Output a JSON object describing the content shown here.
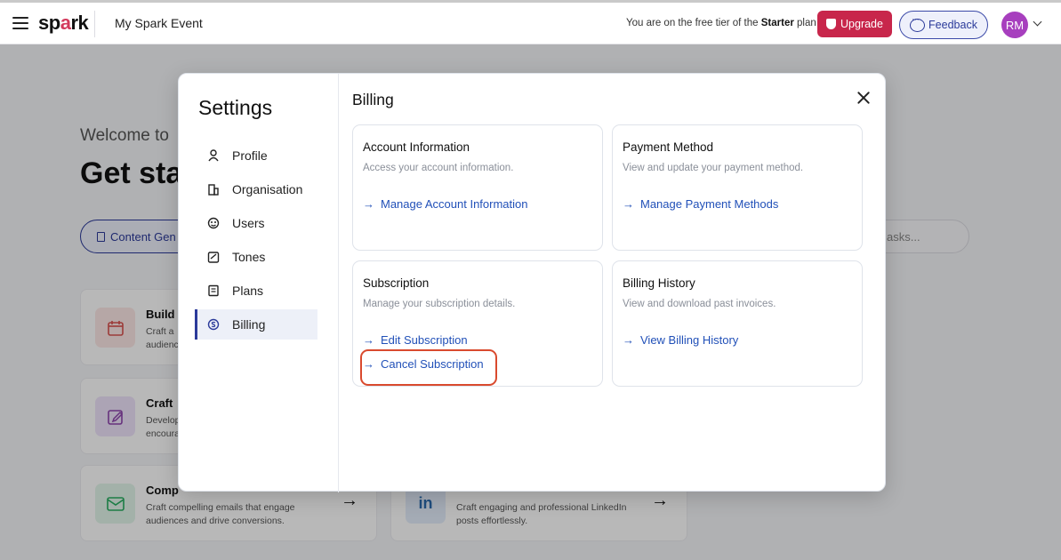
{
  "topbar": {
    "logo_pre": "sp",
    "logo_accent": "a",
    "logo_post": "rk",
    "event_name": "My Spark Event",
    "tier_prefix": "You are on the free tier of the",
    "tier_plan": "Starter",
    "tier_suffix": "plan",
    "upgrade_label": "Upgrade",
    "feedback_label": "Feedback",
    "avatar_initials": "RM"
  },
  "background": {
    "welcome": "Welcome to",
    "heading": "Get sta",
    "content_pill": "Content Gen",
    "search_placeholder": "asks...",
    "cards": [
      {
        "title": "Build",
        "desc": "Craft a\naudienc",
        "icon": "calendar-icon",
        "color": "#fde8e6"
      },
      {
        "title": "Craft",
        "desc": "Develop\nencoura",
        "icon": "edit-icon",
        "color": "#efe4fb"
      },
      {
        "title": "Comp",
        "desc": "Craft compelling emails that engage audiences and drive conversions.",
        "icon": "mail-icon",
        "color": "#e2f5ea"
      },
      {
        "title": "",
        "desc": "Craft engaging and professional LinkedIn posts effortlessly.",
        "icon": "linkedin-icon",
        "color": "#e3edfb"
      }
    ]
  },
  "modal": {
    "settings_title": "Settings",
    "nav": [
      {
        "label": "Profile",
        "icon": "user-icon"
      },
      {
        "label": "Organisation",
        "icon": "building-icon"
      },
      {
        "label": "Users",
        "icon": "users-icon"
      },
      {
        "label": "Tones",
        "icon": "tones-icon"
      },
      {
        "label": "Plans",
        "icon": "plans-icon"
      },
      {
        "label": "Billing",
        "icon": "billing-icon",
        "active": true
      }
    ],
    "billing_title": "Billing",
    "cards": {
      "account": {
        "title": "Account Information",
        "desc": "Access your account information.",
        "link": "Manage Account Information"
      },
      "payment": {
        "title": "Payment Method",
        "desc": "View and update your payment method.",
        "link": "Manage Payment Methods"
      },
      "subscription": {
        "title": "Subscription",
        "desc": "Manage your subscription details.",
        "link_edit": "Edit Subscription",
        "link_cancel": "Cancel Subscription"
      },
      "history": {
        "title": "Billing History",
        "desc": "View and download past invoices.",
        "link": "View Billing History"
      }
    }
  },
  "colors": {
    "brand": "#d33a5c",
    "upgrade": "#c8264b",
    "primary": "#2b3a9a",
    "link": "#2150b8",
    "highlight": "#d94a2e"
  }
}
